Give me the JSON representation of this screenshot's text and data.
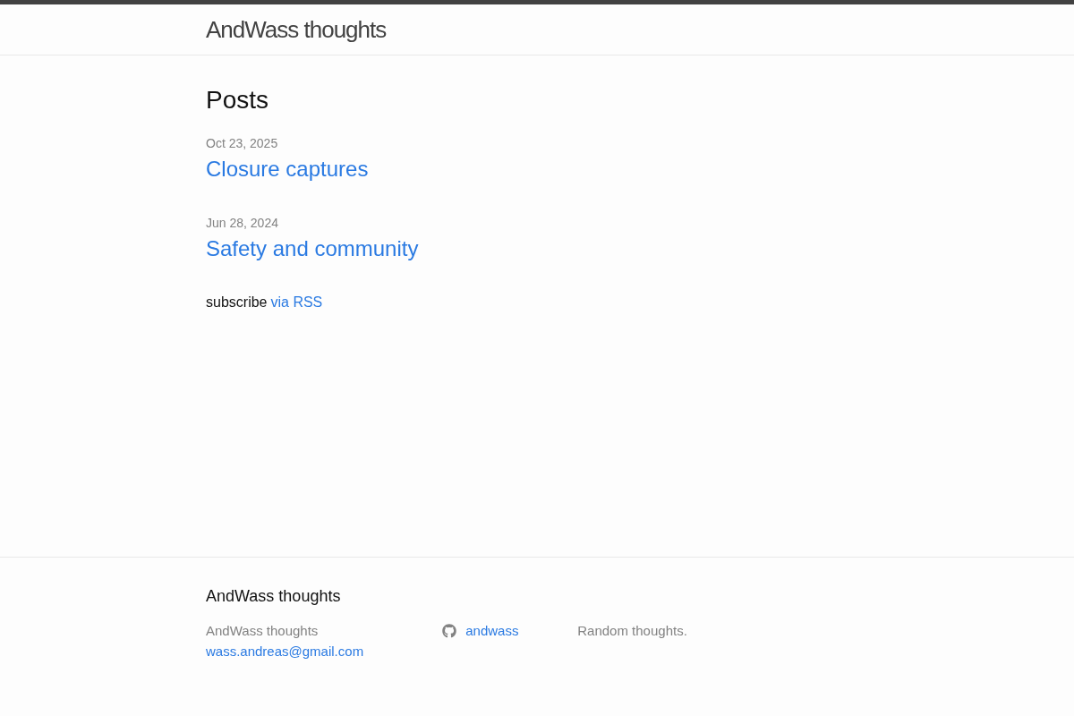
{
  "header": {
    "site_title": "AndWass thoughts"
  },
  "main": {
    "heading": "Posts",
    "posts": [
      {
        "date": "Oct 23, 2025",
        "title": "Closure captures"
      },
      {
        "date": "Jun 28, 2024",
        "title": "Safety and community"
      }
    ],
    "subscribe": {
      "text": "subscribe",
      "link": "via RSS"
    }
  },
  "footer": {
    "heading": "AndWass thoughts",
    "site_name": "AndWass thoughts",
    "email": "wass.andreas@gmail.com",
    "github": "andwass",
    "description": "Random thoughts."
  }
}
